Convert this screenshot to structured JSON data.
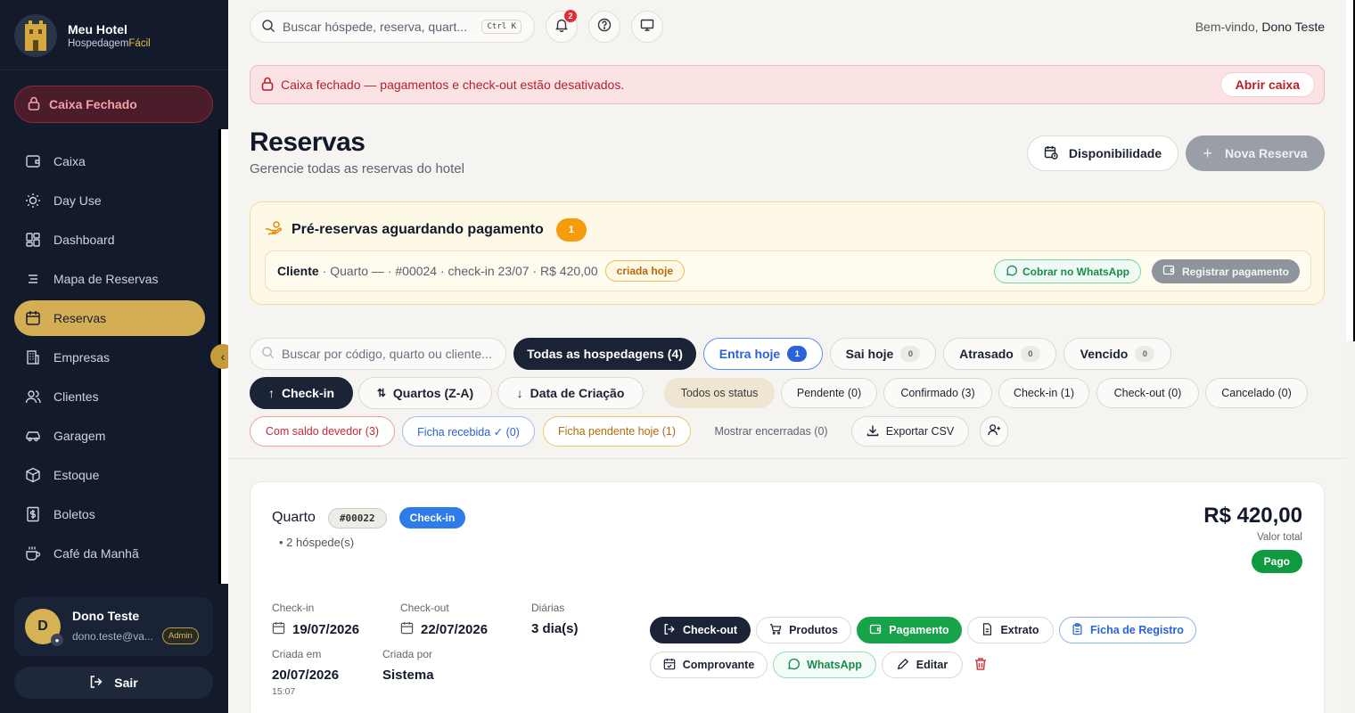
{
  "brand": {
    "name": "Meu Hotel",
    "tag_main": "Hospedagem",
    "tag_accent": "Fácil"
  },
  "sidebar": {
    "caixa_label": "Caixa Fechado",
    "items": [
      {
        "label": "Caixa",
        "icon": "wallet-icon"
      },
      {
        "label": "Day Use",
        "icon": "sun-icon"
      },
      {
        "label": "Dashboard",
        "icon": "dashboard-icon"
      },
      {
        "label": "Mapa de Reservas",
        "icon": "list-icon"
      },
      {
        "label": "Reservas",
        "icon": "calendar-icon",
        "active": true
      },
      {
        "label": "Empresas",
        "icon": "building-icon"
      },
      {
        "label": "Clientes",
        "icon": "users-icon"
      },
      {
        "label": "Garagem",
        "icon": "car-icon"
      },
      {
        "label": "Estoque",
        "icon": "box-icon"
      },
      {
        "label": "Boletos",
        "icon": "receipt-icon"
      },
      {
        "label": "Café da Manhã",
        "icon": "coffee-icon"
      }
    ],
    "user": {
      "initial": "D",
      "name": "Dono Teste",
      "email": "dono.teste@va...",
      "role": "Admin"
    },
    "logout_label": "Sair"
  },
  "topbar": {
    "search_placeholder": "Buscar hóspede, reserva, quart...",
    "shortcut": "Ctrl K",
    "notifications": "2",
    "welcome_prefix": "Bem-vindo,",
    "welcome_name": "Dono Teste"
  },
  "alert": {
    "text": "Caixa fechado — pagamentos e check-out estão desativados.",
    "action": "Abrir caixa"
  },
  "page": {
    "title": "Reservas",
    "subtitle": "Gerencie todas as reservas do hotel",
    "availability_label": "Disponibilidade",
    "new_label": "Nova Reserva"
  },
  "pre_reservas": {
    "title": "Pré-reservas aguardando pagamento",
    "count": "1",
    "client": "Cliente",
    "details": "· Quarto — · #00024 · check-in 23/07 · R$ 420,00",
    "tag": "criada hoje",
    "whatsapp_label": "Cobrar no WhatsApp",
    "register_label": "Registrar pagamento"
  },
  "filters": {
    "search_placeholder": "Buscar por código, quarto ou cliente...",
    "row1": [
      {
        "label": "Todas as hospedagens (4)"
      },
      {
        "label": "Entra hoje",
        "count": "1"
      },
      {
        "label": "Sai hoje",
        "count": "0"
      },
      {
        "label": "Atrasado",
        "count": "0"
      },
      {
        "label": "Vencido",
        "count": "0"
      }
    ],
    "sort": [
      {
        "label": "Check-in"
      },
      {
        "label": "Quartos (Z-A)"
      },
      {
        "label": "Data de Criação"
      }
    ],
    "status": [
      {
        "label": "Todos os status"
      },
      {
        "label": "Pendente (0)"
      },
      {
        "label": "Confirmado (3)"
      },
      {
        "label": "Check-in (1)"
      },
      {
        "label": "Check-out (0)"
      },
      {
        "label": "Cancelado (0)"
      }
    ],
    "row3": [
      {
        "label": "Com saldo devedor (3)"
      },
      {
        "label": "Ficha recebida ✓ (0)"
      },
      {
        "label": "Ficha pendente hoje (1)"
      },
      {
        "label": "Mostrar encerradas (0)"
      },
      {
        "label": "Exportar CSV"
      }
    ]
  },
  "reservation": {
    "room": "Quarto",
    "code": "#00022",
    "status": "Check-in",
    "guests": "2 hóspede(s)",
    "price": "R$ 420,00",
    "price_label": "Valor total",
    "payment_status": "Pago",
    "checkin_label": "Check-in",
    "checkin": "19/07/2026",
    "checkout_label": "Check-out",
    "checkout": "22/07/2026",
    "nights_label": "Diárias",
    "nights": "3 dia(s)",
    "created_label": "Criada em",
    "created": "20/07/2026",
    "created_time": "15:07",
    "created_by_label": "Criada por",
    "created_by": "Sistema",
    "actions": [
      "Check-out",
      "Produtos",
      "Pagamento",
      "Extrato",
      "Ficha de Registro",
      "Comprovante",
      "WhatsApp",
      "Editar"
    ]
  },
  "colors": {
    "sidebar_bg": "#121a2c",
    "accent_gold": "#d3ae55",
    "danger": "#b5202d",
    "primary_dark": "#1b2336",
    "success": "#17a34a",
    "info": "#2f7bea"
  }
}
